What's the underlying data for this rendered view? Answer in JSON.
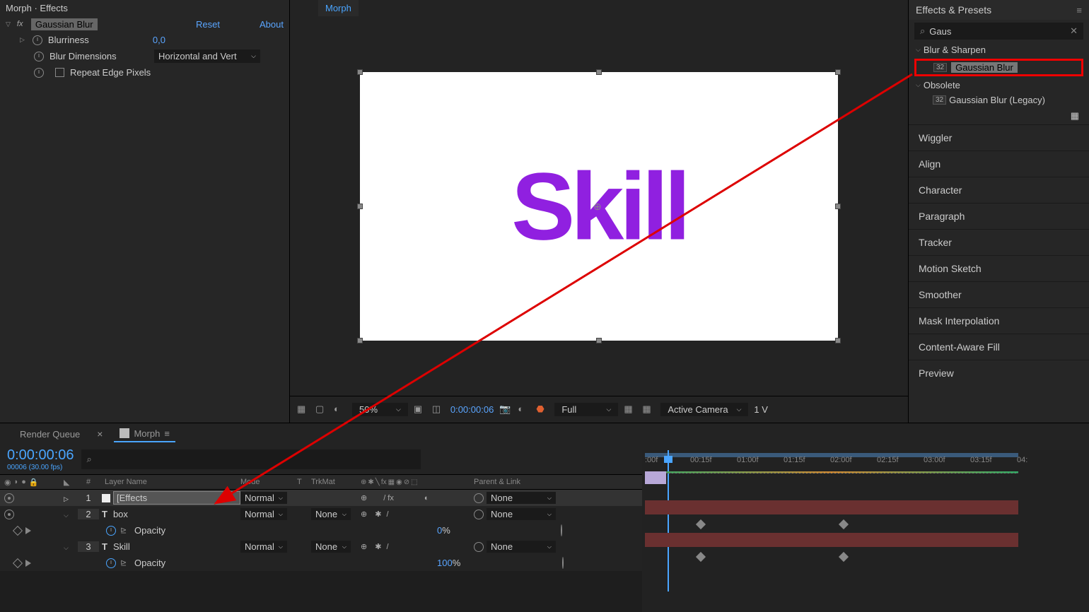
{
  "effects_panel": {
    "header": "Morph · Effects",
    "effect_name": "Gaussian Blur",
    "reset": "Reset",
    "about": "About",
    "props": {
      "blurriness": {
        "label": "Blurriness",
        "value": "0,0"
      },
      "dimensions": {
        "label": "Blur Dimensions",
        "value": "Horizontal and Vert"
      },
      "repeat": {
        "label": "Repeat Edge Pixels"
      }
    }
  },
  "viewer": {
    "tab": "Morph",
    "text": "Skill",
    "controls": {
      "zoom": "50%",
      "timecode": "0:00:00:06",
      "resolution": "Full",
      "camera": "Active Camera",
      "views": "1 V"
    }
  },
  "right_panel": {
    "title": "Effects & Presets",
    "search": "Gaus",
    "tree": {
      "cat1": "Blur & Sharpen",
      "item1": "Gaussian Blur",
      "cat2": "Obsolete",
      "item2": "Gaussian Blur (Legacy)"
    },
    "panels": [
      "Wiggler",
      "Align",
      "Character",
      "Paragraph",
      "Tracker",
      "Motion Sketch",
      "Smoother",
      "Mask Interpolation",
      "Content-Aware Fill",
      "Preview"
    ]
  },
  "timeline": {
    "tabs": {
      "render": "Render Queue",
      "morph": "Morph"
    },
    "timecode": "0:00:00:06",
    "sub_timecode": "00006 (30.00 fps)",
    "headers": {
      "num": "#",
      "name": "Layer Name",
      "mode": "Mode",
      "t": "T",
      "trk": "TrkMat",
      "parent": "Parent & Link"
    },
    "layers": [
      {
        "num": "1",
        "name": "[Effects",
        "mode": "Normal",
        "trk": "",
        "parent": "None",
        "type": "adj"
      },
      {
        "num": "2",
        "name": "box",
        "mode": "Normal",
        "trk": "None",
        "parent": "None",
        "type": "text"
      },
      {
        "num": "3",
        "name": "Skill",
        "mode": "Normal",
        "trk": "None",
        "parent": "None",
        "type": "text"
      }
    ],
    "props": {
      "opacity_label": "Opacity",
      "opacity_val_0": "0",
      "opacity_val_100": "100",
      "percent": "%"
    },
    "ruler": [
      ":00f",
      "00:15f",
      "01:00f",
      "01:15f",
      "02:00f",
      "02:15f",
      "03:00f",
      "03:15f",
      "04:"
    ]
  }
}
